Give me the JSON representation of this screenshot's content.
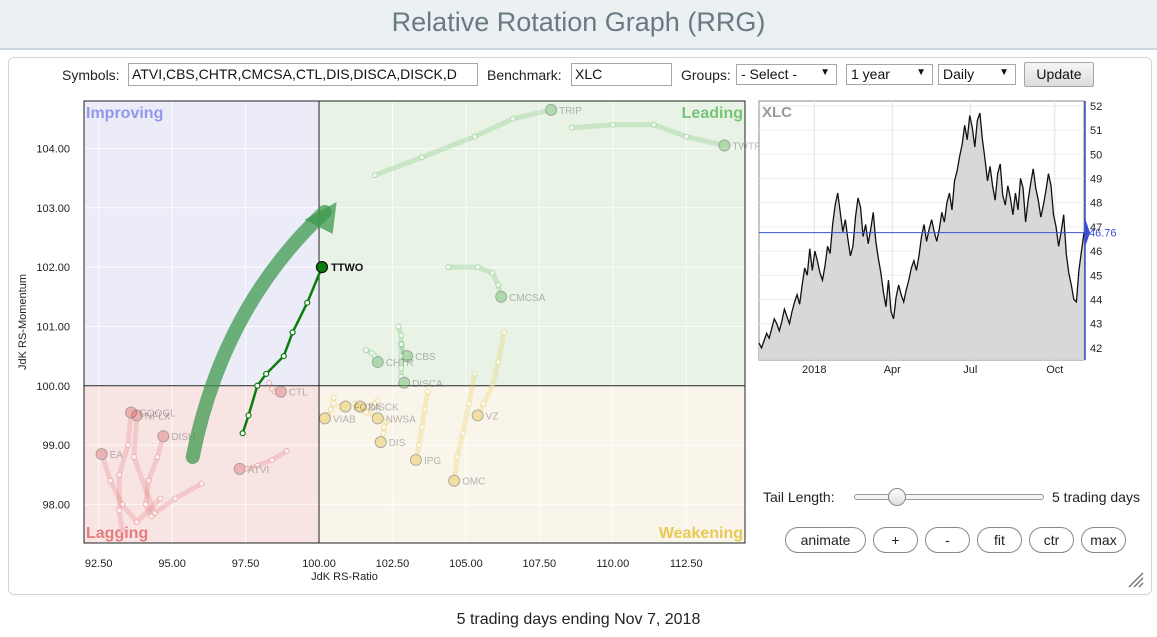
{
  "page_title": "Relative Rotation Graph (RRG)",
  "controls": {
    "symbols_label": "Symbols:",
    "symbols_value": "ATVI,CBS,CHTR,CMCSA,CTL,DIS,DISCA,DISCK,D",
    "benchmark_label": "Benchmark:",
    "benchmark_value": "XLC",
    "groups_label": "Groups:",
    "groups_value": "- Select -",
    "period_value": "1 year",
    "frequency_value": "Daily",
    "update_label": "Update"
  },
  "tail": {
    "label": "Tail Length:",
    "value_label": "5 trading days",
    "slider_fraction": 0.18
  },
  "buttons": {
    "animate": "animate",
    "plus": "+",
    "minus": "-",
    "fit": "fit",
    "ctr": "ctr",
    "max": "max"
  },
  "footer": "5 trading days ending Nov 7, 2018",
  "colors": {
    "improving": "#7b83e8",
    "leading": "#5cb85c",
    "lagging": "#e06b6b",
    "weakening": "#e8c23a",
    "highlight": "#0a7d0a"
  },
  "chart_data": [
    {
      "type": "scatter",
      "xlabel": "JdK RS-Ratio",
      "ylabel": "JdK RS-Momentum",
      "xlim": [
        92.0,
        114.5
      ],
      "ylim": [
        97.35,
        104.8
      ],
      "x_ticks": [
        "92.50",
        "95.00",
        "97.50",
        "100.00",
        "102.50",
        "105.00",
        "107.50",
        "110.00",
        "112.50"
      ],
      "x_tick_values": [
        92.5,
        95,
        97.5,
        100,
        102.5,
        105,
        107.5,
        110,
        112.5
      ],
      "y_ticks": [
        "98.00",
        "99.00",
        "100.00",
        "101.00",
        "102.00",
        "103.00",
        "104.00"
      ],
      "y_tick_values": [
        98,
        99,
        100,
        101,
        102,
        103,
        104
      ],
      "quadrants": {
        "improving": "Improving",
        "leading": "Leading",
        "lagging": "Lagging",
        "weakening": "Weakening"
      },
      "highlight": {
        "name": "TTWO",
        "tail": [
          [
            97.4,
            99.2
          ],
          [
            97.6,
            99.5
          ],
          [
            97.9,
            100.0
          ],
          [
            98.2,
            100.2
          ],
          [
            98.8,
            100.5
          ],
          [
            99.1,
            100.9
          ],
          [
            99.6,
            101.4
          ],
          [
            100.1,
            102.0
          ]
        ]
      },
      "series": [
        {
          "name": "TRIP",
          "color": "#5cb85c",
          "tail": [
            [
              101.9,
              103.55
            ],
            [
              103.5,
              103.85
            ],
            [
              105.3,
              104.2
            ],
            [
              106.6,
              104.5
            ],
            [
              107.9,
              104.65
            ]
          ]
        },
        {
          "name": "TWTR",
          "color": "#5cb85c",
          "tail": [
            [
              108.6,
              104.35
            ],
            [
              110.0,
              104.4
            ],
            [
              111.4,
              104.4
            ],
            [
              112.5,
              104.2
            ],
            [
              113.8,
              104.05
            ]
          ]
        },
        {
          "name": "CMCSA",
          "color": "#5cb85c",
          "tail": [
            [
              104.4,
              102.0
            ],
            [
              105.4,
              102.0
            ],
            [
              105.9,
              101.9
            ],
            [
              106.1,
              101.7
            ],
            [
              106.2,
              101.5
            ]
          ]
        },
        {
          "name": "CBS",
          "color": "#5cb85c",
          "tail": [
            [
              102.7,
              101.0
            ],
            [
              102.8,
              100.85
            ],
            [
              102.8,
              100.7
            ],
            [
              102.9,
              100.55
            ],
            [
              103.0,
              100.5
            ]
          ]
        },
        {
          "name": "CHTR",
          "color": "#5cb85c",
          "tail": [
            [
              101.6,
              100.6
            ],
            [
              101.8,
              100.55
            ],
            [
              101.9,
              100.5
            ],
            [
              102.0,
              100.45
            ],
            [
              102.0,
              100.4
            ]
          ]
        },
        {
          "name": "DISCA",
          "color": "#5cb85c",
          "tail": [
            [
              102.8,
              100.7
            ],
            [
              102.8,
              100.5
            ],
            [
              102.8,
              100.3
            ],
            [
              102.8,
              100.15
            ],
            [
              102.9,
              100.05
            ]
          ]
        },
        {
          "name": "VZ",
          "color": "#e8c23a",
          "tail": [
            [
              106.3,
              100.9
            ],
            [
              106.1,
              100.4
            ],
            [
              105.9,
              100.0
            ],
            [
              105.6,
              99.7
            ],
            [
              105.4,
              99.5
            ]
          ]
        },
        {
          "name": "OMC",
          "color": "#e8c23a",
          "tail": [
            [
              105.3,
              100.2
            ],
            [
              105.1,
              99.7
            ],
            [
              104.9,
              99.2
            ],
            [
              104.7,
              98.8
            ],
            [
              104.6,
              98.4
            ]
          ]
        },
        {
          "name": "IPG",
          "color": "#e8c23a",
          "tail": [
            [
              103.7,
              99.9
            ],
            [
              103.6,
              99.6
            ],
            [
              103.5,
              99.3
            ],
            [
              103.4,
              99.0
            ],
            [
              103.3,
              98.75
            ]
          ]
        },
        {
          "name": "DIS",
          "color": "#e8c23a",
          "tail": [
            [
              102.3,
              99.4
            ],
            [
              102.2,
              99.3
            ],
            [
              102.2,
              99.2
            ],
            [
              102.1,
              99.1
            ],
            [
              102.1,
              99.05
            ]
          ]
        },
        {
          "name": "NWSA",
          "color": "#e8c23a",
          "tail": [
            [
              101.2,
              99.7
            ],
            [
              101.4,
              99.6
            ],
            [
              101.6,
              99.55
            ],
            [
              101.9,
              99.5
            ],
            [
              102.0,
              99.45
            ]
          ]
        },
        {
          "name": "VIAB",
          "color": "#e8c23a",
          "tail": [
            [
              100.5,
              99.8
            ],
            [
              100.5,
              99.7
            ],
            [
              100.4,
              99.6
            ],
            [
              100.3,
              99.5
            ],
            [
              100.2,
              99.45
            ]
          ]
        },
        {
          "name": "DISCK",
          "color": "#e8c23a",
          "tail": [
            [
              102.0,
              99.75
            ],
            [
              101.9,
              99.7
            ],
            [
              101.7,
              99.65
            ],
            [
              101.5,
              99.65
            ],
            [
              101.4,
              99.65
            ]
          ]
        },
        {
          "name": "FOXA",
          "color": "#e8c23a",
          "tail": [
            [
              100.7,
              99.65
            ],
            [
              100.8,
              99.65
            ],
            [
              100.9,
              99.65
            ],
            [
              100.9,
              99.65
            ],
            [
              100.9,
              99.65
            ]
          ]
        },
        {
          "name": "CTL",
          "color": "#e06b6b",
          "tail": [
            [
              98.3,
              100.05
            ],
            [
              98.4,
              99.95
            ],
            [
              98.5,
              99.9
            ],
            [
              98.6,
              99.9
            ],
            [
              98.7,
              99.9
            ]
          ]
        },
        {
          "name": "ATVI",
          "color": "#e06b6b",
          "tail": [
            [
              98.9,
              98.9
            ],
            [
              98.4,
              98.75
            ],
            [
              97.9,
              98.65
            ],
            [
              97.5,
              98.6
            ],
            [
              97.3,
              98.6
            ]
          ]
        },
        {
          "name": "NFLX",
          "color": "#e06b6b",
          "tail": [
            [
              96.0,
              98.35
            ],
            [
              95.1,
              98.1
            ],
            [
              94.4,
              97.85
            ],
            [
              93.7,
              98.8
            ],
            [
              93.8,
              99.5
            ]
          ]
        },
        {
          "name": "EA",
          "color": "#e06b6b",
          "tail": [
            [
              94.6,
              98.1
            ],
            [
              93.8,
              97.7
            ],
            [
              93.3,
              98.0
            ],
            [
              92.9,
              98.4
            ],
            [
              92.6,
              98.85
            ]
          ]
        },
        {
          "name": "DISH",
          "color": "#e06b6b",
          "tail": [
            [
              94.3,
              97.8
            ],
            [
              94.1,
              98.0
            ],
            [
              94.2,
              98.4
            ],
            [
              94.5,
              98.8
            ],
            [
              94.7,
              99.15
            ]
          ]
        },
        {
          "name": "GOOGL",
          "color": "#e06b6b",
          "tail": [
            [
              93.3,
              97.55
            ],
            [
              93.2,
              97.9
            ],
            [
              93.2,
              98.5
            ],
            [
              93.5,
              99.0
            ],
            [
              93.6,
              99.55
            ]
          ]
        }
      ],
      "arrow": {
        "from": [
          95.7,
          98.8
        ],
        "to": [
          100.6,
          103.1
        ]
      }
    },
    {
      "type": "line",
      "title": "XLC",
      "x_ticks": [
        "2018",
        "Apr",
        "Jul",
        "Oct"
      ],
      "y_ticks": [
        "42",
        "43",
        "44",
        "45",
        "46",
        "47",
        "48",
        "49",
        "50",
        "51",
        "52"
      ],
      "ylim": [
        41.5,
        52.2
      ],
      "last_value": 46.76,
      "last_value_label": "46.76",
      "values": [
        42.2,
        42.0,
        42.3,
        42.6,
        42.4,
        42.8,
        43.2,
        43.0,
        42.7,
        43.1,
        43.6,
        43.3,
        43.0,
        43.5,
        43.9,
        44.2,
        43.8,
        44.6,
        45.3,
        45.0,
        46.1,
        45.2,
        46.0,
        45.6,
        45.1,
        44.8,
        45.4,
        46.2,
        45.9,
        47.1,
        47.9,
        48.4,
        47.6,
        46.8,
        47.3,
        46.5,
        45.8,
        46.2,
        47.4,
        48.2,
        47.8,
        46.6,
        47.1,
        46.3,
        46.9,
        47.6,
        46.4,
        45.7,
        45.1,
        44.3,
        43.7,
        44.8,
        43.5,
        43.2,
        44.1,
        44.6,
        44.2,
        43.9,
        44.4,
        44.8,
        45.3,
        45.6,
        45.2,
        45.8,
        46.6,
        47.1,
        46.4,
        46.9,
        47.3,
        46.8,
        46.4,
        46.9,
        47.6,
        47.2,
        48.0,
        48.4,
        47.7,
        48.9,
        49.3,
        49.9,
        50.4,
        51.2,
        50.6,
        51.6,
        51.1,
        50.3,
        51.4,
        51.7,
        50.6,
        49.8,
        48.9,
        49.5,
        48.7,
        48.1,
        49.2,
        49.6,
        48.3,
        47.9,
        48.7,
        48.2,
        47.5,
        48.4,
        47.7,
        49.0,
        48.6,
        47.2,
        48.1,
        48.8,
        49.4,
        48.6,
        48.1,
        47.4,
        47.9,
        48.5,
        49.2,
        48.7,
        47.5,
        47.0,
        46.2,
        46.8,
        47.5,
        45.9,
        45.1,
        44.6,
        44.0,
        43.9,
        45.2,
        46.0,
        46.76
      ]
    }
  ]
}
